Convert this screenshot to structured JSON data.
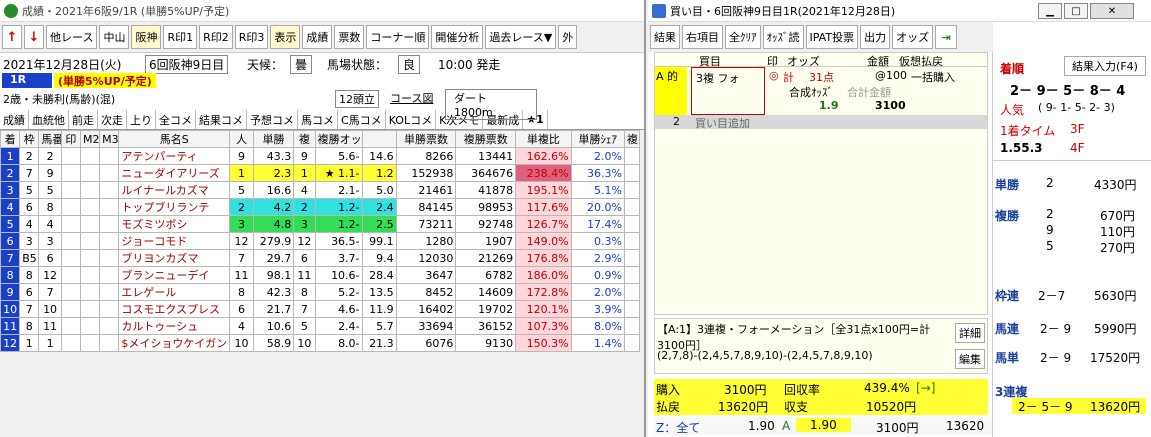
{
  "left": {
    "title": "成績・2021年6阪9/1R (単勝5%UP/予定)",
    "toolbar": [
      "他レース",
      "中山",
      "阪神",
      "R印1",
      "R印2",
      "R印3",
      "表示",
      "成績",
      "票数",
      "コーナー順",
      "開催分析",
      "過去レース▼",
      "外"
    ],
    "date": "2021年12月28日(火)",
    "kai": "6回阪神9日目",
    "tenko_label": "天候：",
    "tenko": "曇",
    "baba_label": "馬場状態：",
    "baba": "良",
    "time": "10:00 発走",
    "race_no": "1R",
    "race_note": "(単勝5%UP/予定)",
    "cond": "2歳・未勝利(馬齢)(混)",
    "heads": "12頭立",
    "course_btn": "コース図",
    "course": "ダート 1800m",
    "tabs": [
      "成績",
      "血統他",
      "前走",
      "次走",
      "上り",
      "全コメ",
      "結果コメ",
      "予想コメ",
      "馬コメ",
      "C馬コメ",
      "KOLコメ",
      "K次メモ",
      "最新成",
      "★1"
    ],
    "headers": [
      "着",
      "枠",
      "馬番",
      "印",
      "M2",
      "M3",
      "馬名S",
      "人",
      "単勝",
      "複",
      "複勝オッズ",
      "",
      "単勝票数",
      "複勝票数",
      "単複比",
      "単勝ｼｪｱ",
      "複"
    ],
    "rows": [
      [
        "1",
        "2",
        "2",
        "",
        "",
        "",
        "アテンパーティ",
        "9",
        "43.3",
        "9",
        "5.6-",
        "14.6",
        "8266",
        "13441",
        "162.6%",
        "2.0%"
      ],
      [
        "2",
        "7",
        "9",
        "",
        "",
        "",
        "ニューダイアリーズ",
        "1",
        "2.3",
        "1",
        "★ 1.1-",
        "1.2",
        "152938",
        "364676",
        "238.4%",
        "36.3%"
      ],
      [
        "3",
        "5",
        "5",
        "",
        "",
        "",
        "ルイナールカズマ",
        "5",
        "16.6",
        "4",
        "2.1-",
        "5.0",
        "21461",
        "41878",
        "195.1%",
        "5.1%"
      ],
      [
        "4",
        "6",
        "8",
        "",
        "",
        "",
        "トップブリランテ",
        "2",
        "4.2",
        "2",
        "1.2-",
        "2.4",
        "84145",
        "98953",
        "117.6%",
        "20.0%"
      ],
      [
        "5",
        "4",
        "4",
        "",
        "",
        "",
        "モズミツボシ",
        "3",
        "4.8",
        "3",
        "1.2-",
        "2.5",
        "73211",
        "92748",
        "126.7%",
        "17.4%"
      ],
      [
        "6",
        "3",
        "3",
        "",
        "",
        "",
        "ジョーコモド",
        "12",
        "279.9",
        "12",
        "36.5-",
        "99.1",
        "1280",
        "1907",
        "149.0%",
        "0.3%"
      ],
      [
        "7",
        "B5",
        "6",
        "",
        "",
        "",
        "ブリヨンカズマ",
        "7",
        "29.7",
        "6",
        "3.7-",
        "9.4",
        "12030",
        "21269",
        "176.8%",
        "2.9%"
      ],
      [
        "8",
        "8",
        "12",
        "",
        "",
        "",
        "ブランニューデイ",
        "11",
        "98.1",
        "11",
        "10.6-",
        "28.4",
        "3647",
        "6782",
        "186.0%",
        "0.9%"
      ],
      [
        "9",
        "6",
        "7",
        "",
        "",
        "",
        "エレゲール",
        "8",
        "42.3",
        "8",
        "5.2-",
        "13.5",
        "8452",
        "14609",
        "172.8%",
        "2.0%"
      ],
      [
        "10",
        "7",
        "10",
        "",
        "",
        "",
        "コスモエクスプレス",
        "6",
        "21.7",
        "7",
        "4.6-",
        "11.9",
        "16402",
        "19702",
        "120.1%",
        "3.9%"
      ],
      [
        "11",
        "8",
        "11",
        "",
        "",
        "",
        "カルトゥーシュ",
        "4",
        "10.6",
        "5",
        "2.4-",
        "5.7",
        "33694",
        "36152",
        "107.3%",
        "8.0%"
      ],
      [
        "12",
        "1",
        "1",
        "",
        "",
        "",
        "$メイショウケイガン",
        "10",
        "58.9",
        "10",
        "8.0-",
        "21.3",
        "6076",
        "9130",
        "150.3%",
        "1.4%"
      ]
    ]
  },
  "right": {
    "title": "買い目・6回阪神9日目1R(2021年12月28日)",
    "toolbar": [
      "結果",
      "右項目",
      "全ｸﾘｱ",
      "ｵｯｽﾞ読",
      "IPAT投票",
      "出力",
      "オッズ"
    ],
    "bet_head": [
      "買目",
      "印",
      "オッズ",
      "金額",
      "仮想払戻"
    ],
    "bet_a": "A 的",
    "bet_type": "3複 フォ",
    "mark": "◎",
    "kei": "計",
    "points": "31点",
    "unit": "@100",
    "ikkatsu": "一括購入",
    "gosei_label": "合成ｵｯｽﾞ",
    "gokei_label": "合計金額",
    "gosei": "1.9",
    "gokei": "3100",
    "row2_no": "2",
    "row2_label": "買い目追加",
    "detail": "【A:1】3連複・フォーメーション［全31点x100円=計3100円］",
    "detail2": "(2,7,8)-(2,4,5,7,8,9,10)-(2,4,5,7,8,9,10)",
    "shousai": "詳細",
    "henshu": "編集",
    "kounyu_l": "購入",
    "kounyu": "3100円",
    "kaishu_l": "回収率",
    "kaishu": "439.4%",
    "kaishu_arrow": "[→]",
    "haraimodoshi_l": "払戻",
    "haraimodoshi": "13620円",
    "shushi_l": "収支",
    "shushi": "10520円",
    "status": [
      "Z：全て",
      "1.90",
      "A",
      "1.90",
      "3100円",
      "13620"
    ]
  },
  "payout": {
    "chakujun_l": "着順",
    "kekka_btn": "結果入力(F4)",
    "chakujun": "2－ 9－ 5－ 8－ 4",
    "ninki_l": "人気",
    "ninki": "( 9- 1- 5- 2- 3)",
    "time_l": "1着タイム",
    "time": "1.55.3",
    "f3_l": "3F",
    "f4_l": "4F",
    "tansho_l": "単勝",
    "tansho": [
      [
        "2",
        "4330円"
      ]
    ],
    "fukusho_l": "複勝",
    "fukusho": [
      [
        "2",
        "670円"
      ],
      [
        "9",
        "110円"
      ],
      [
        "5",
        "270円"
      ]
    ],
    "wakuren_l": "枠連",
    "wakuren": "2－7",
    "wakuren_v": "5630円",
    "umaren_l": "馬連",
    "umaren": "2－ 9",
    "umaren_v": "5990円",
    "umatan_l": "馬単",
    "umatan": "2－ 9",
    "umatan_v": "17520円",
    "sanfuku_l": "3連複",
    "sanfuku": "2－ 5－ 9",
    "sanfuku_v": "13620円"
  }
}
